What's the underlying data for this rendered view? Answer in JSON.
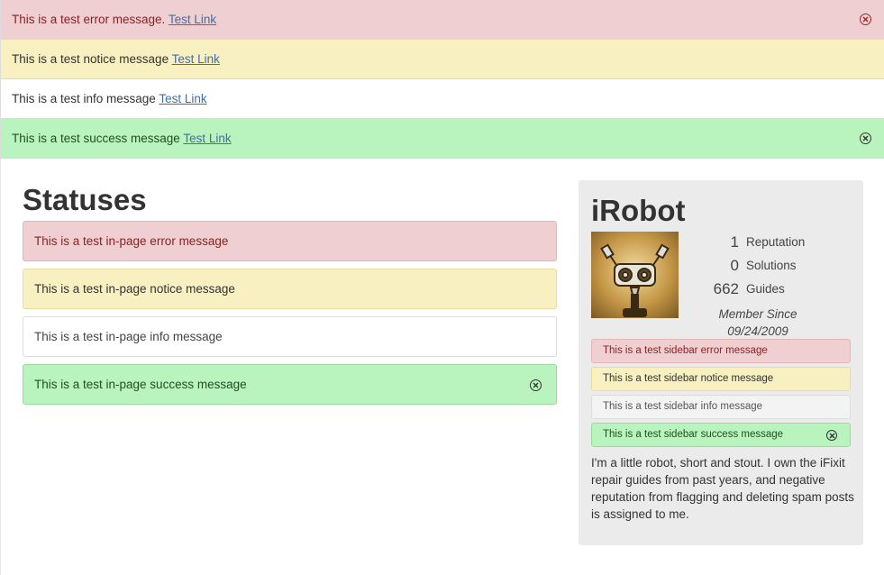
{
  "flash": {
    "error": {
      "text": "This is a test error message.",
      "link": "Test Link"
    },
    "notice": {
      "text": "This is a test notice message",
      "link": "Test Link"
    },
    "info": {
      "text": "This is a test info message",
      "link": "Test Link"
    },
    "success": {
      "text": "This is a test success message",
      "link": "Test Link"
    }
  },
  "main": {
    "title": "Statuses",
    "messages": {
      "error": "This is a test in-page error message",
      "notice": "This is a test in-page notice message",
      "info": "This is a test in-page info message",
      "success": "This is a test in-page success message"
    }
  },
  "sidebar": {
    "name": "iRobot",
    "stats": [
      {
        "value": "1",
        "label": "Reputation"
      },
      {
        "value": "0",
        "label": "Solutions"
      },
      {
        "value": "662",
        "label": "Guides"
      }
    ],
    "member_since_label": "Member Since",
    "member_since_date": "09/24/2009",
    "messages": {
      "error": "This is a test sidebar error message",
      "notice": "This is a test sidebar notice message",
      "info": "This is a test sidebar info message",
      "success": "This is a test sidebar success message"
    },
    "bio": "I'm a little robot, short and stout. I own the iFixit repair guides from past years, and negative reputation from flagging and deleting spam posts is assigned to me."
  },
  "colors": {
    "error_bg": "#efcfd1",
    "notice_bg": "#f8f0c0",
    "success_bg": "#b9f3bd",
    "sidebar_bg": "#ebebeb",
    "link": "#3f6fa8"
  },
  "icons": {
    "close": "close-circle-icon",
    "avatar": "robot-avatar"
  }
}
